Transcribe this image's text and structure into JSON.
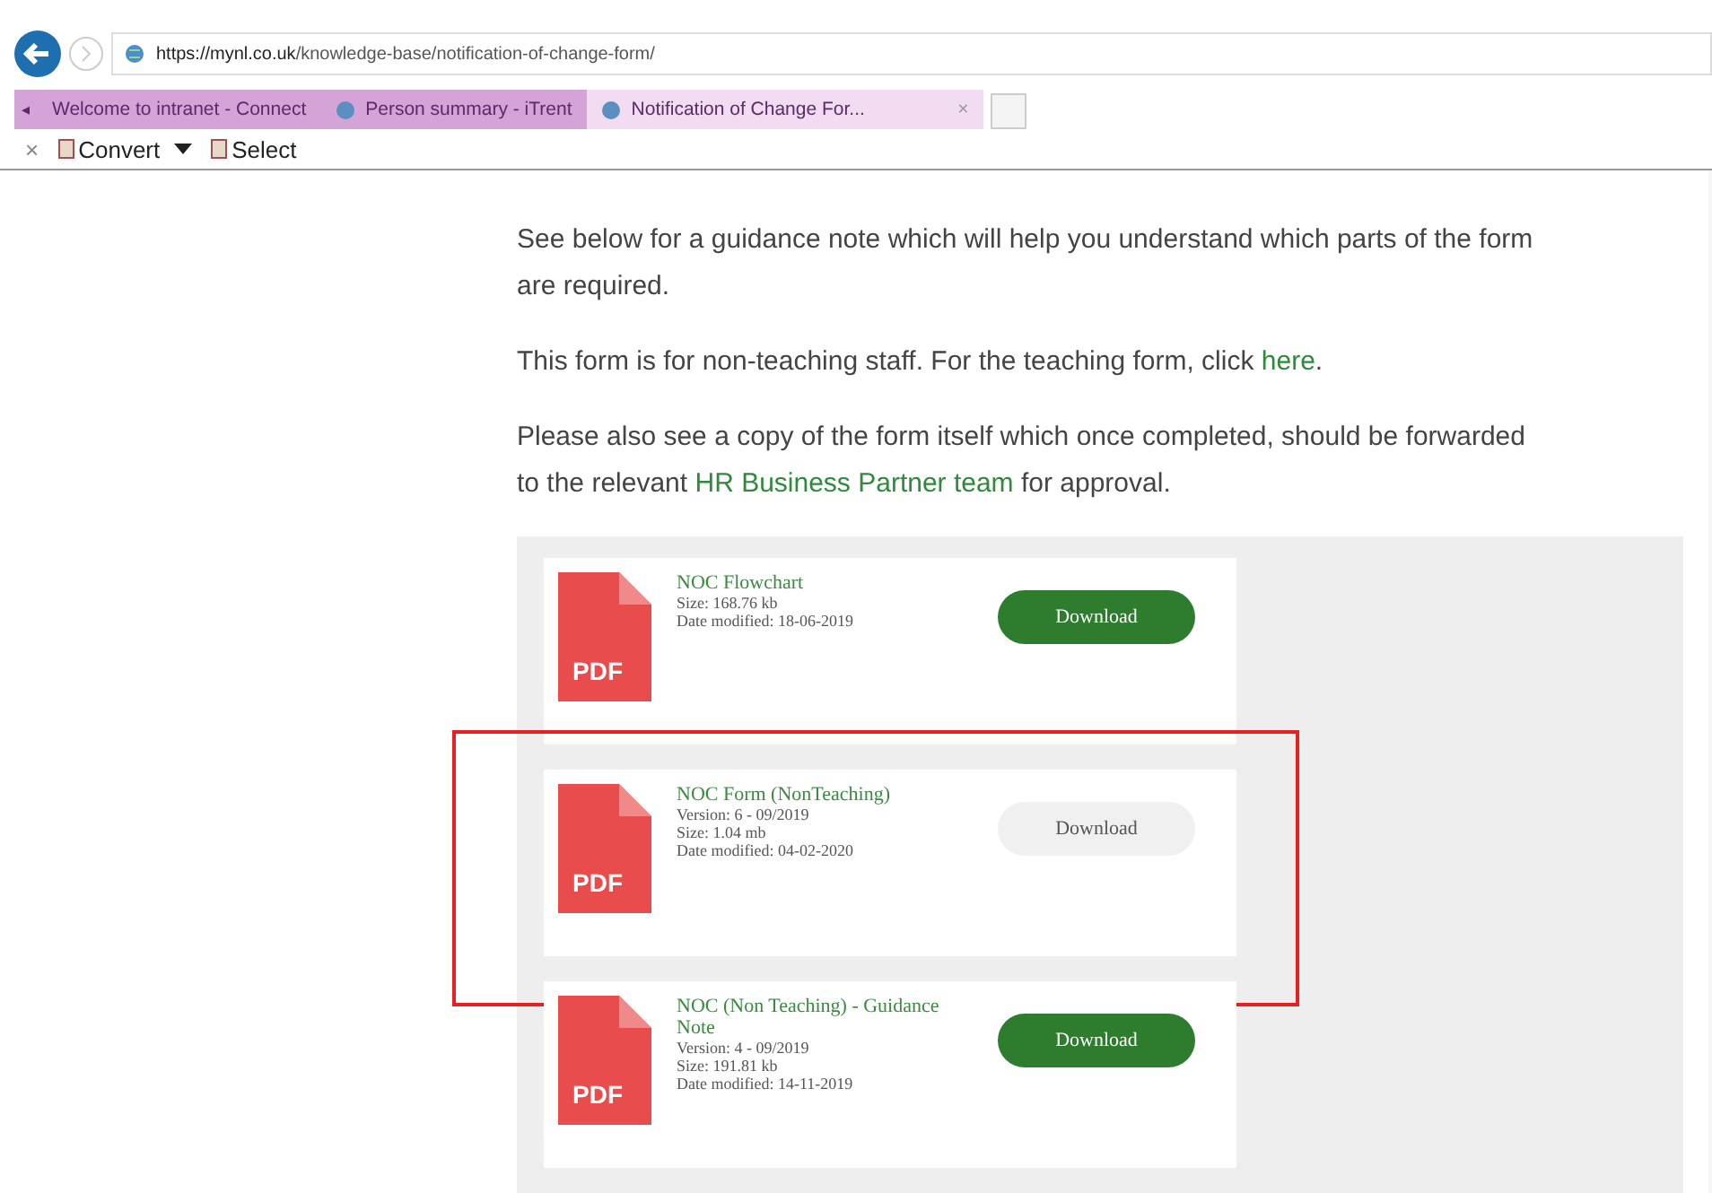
{
  "address_bar": {
    "url_host": "https://mynl.co.uk",
    "url_path": "/knowledge-base/notification-of-change-form/"
  },
  "tab_scroll": "◂",
  "tabs": [
    {
      "label": "Welcome to intranet - Connect",
      "selected": false
    },
    {
      "label": "Person summary - iTrent",
      "selected": false
    },
    {
      "label": "Notification of Change For...",
      "selected": true,
      "close": "×"
    }
  ],
  "toolbar": {
    "close": "×",
    "items": [
      {
        "label": "Convert",
        "dropdown": true
      },
      {
        "label": "Select",
        "dropdown": false
      }
    ]
  },
  "paragraphs": [
    [
      {
        "text": "See below for a guidance note which will help you understand which parts of the form are required.",
        "link": false
      }
    ],
    [
      {
        "text": "This form is for non-teaching staff. For the teaching form, click ",
        "link": false
      },
      {
        "text": "here",
        "link": true
      },
      {
        "text": ".",
        "link": false
      }
    ],
    [
      {
        "text": "Please also see a copy of the form itself which once completed, should be forwarded to the relevant ",
        "link": false
      },
      {
        "text": "HR Business Partner team",
        "link": true
      },
      {
        "text": " for approval.",
        "link": false
      }
    ]
  ],
  "files": [
    {
      "icon_label": "PDF",
      "title": "NOC Flowchart",
      "details": [
        "Size: 168.76 kb",
        "Date modified: 18-06-2019"
      ],
      "button": "Download",
      "hovered": false,
      "marked": false
    },
    {
      "icon_label": "PDF",
      "title": "NOC Form (NonTeaching)",
      "details": [
        "Version: 6 - 09/2019",
        "Size: 1.04 mb",
        "Date modified: 04-02-2020"
      ],
      "button": "Download",
      "hovered": true,
      "marked": true
    },
    {
      "icon_label": "PDF",
      "title": "NOC (Non Teaching) - Guidance Note",
      "details": [
        "Version: 4 - 09/2019",
        "Size: 191.81 kb",
        "Date modified: 14-11-2019"
      ],
      "button": "Download",
      "hovered": false,
      "marked": false
    }
  ]
}
